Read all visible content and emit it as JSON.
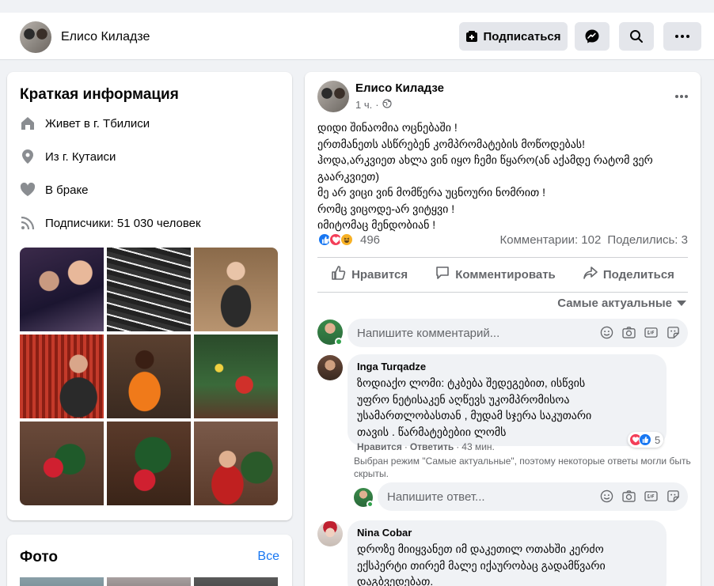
{
  "header": {
    "name": "Елисо Киладзе",
    "subscribe_label": "Подписаться"
  },
  "intro": {
    "title": "Краткая информация",
    "lives_prefix": "Живет в г.",
    "lives_city": "Тбилиси",
    "from_prefix": "Из г.",
    "from_city": "Кутаиси",
    "relationship": "В браке",
    "followers_prefix": "Подписчики:",
    "followers_count": "51 030 человек"
  },
  "photos": {
    "title": "Фото",
    "all_label": "Все"
  },
  "post": {
    "author": "Елисо Киладзе",
    "time": "1 ч.",
    "lines": [
      "დიდი შინაომია ოცნებაში !",
      "ერთმანეთს ასწრებენ კომპრომატების მოწოდებას!",
      "ჰოდა,არკვიეთ ახლა ვინ იყო ჩემი წყარო(ან აქამდე რატომ ვერ",
      "გაარკვიეთ)",
      "მე არ ვიცი ვინ მომწერა უცნოური ნომრით !",
      "რომც ვიცოდე-არ ვიტყვი !",
      "იმიტომაც მენდობიან !"
    ],
    "reactions_count": "496",
    "comments_stat": "Комментарии: 102",
    "shares_stat": "Поделились: 3",
    "like_label": "Нравится",
    "comment_label": "Комментировать",
    "share_label": "Поделиться",
    "sort_label": "Самые актуальные",
    "comment_placeholder": "Напишите комментарий..."
  },
  "comments": [
    {
      "name": "Inga Turqadze",
      "lines": [
        "ზოდიაქო ლომი: ტკბება შედეგებით, ისწვის",
        "უფრო ნეტისაკენ აღწევს უკომპრომისოა",
        "უსამართლობასთან , მუდამ სჯერა საკუთარი",
        "თავის . წარმატებებიი ლომს"
      ],
      "reactions": "5",
      "like": "Нравится",
      "reply": "Ответить",
      "time": "43 мин.",
      "note": "Выбран режим \"Самые актуальные\", поэтому некоторые ответы могли быть скрыты.",
      "reply_placeholder": "Напишите ответ..."
    },
    {
      "name": "Nina Cobar",
      "lines": [
        "დროზე მიიყვანეთ იმ დაკეთილ ოთახში კერძო",
        "ექსპერტი თირემ მალე იქაურობაც გადამწვარი",
        "დაგბვედებათ."
      ]
    }
  ],
  "colors": {
    "accent": "#1877f2",
    "muted": "#65676b",
    "surface": "#f0f2f5",
    "online": "#31a24c"
  }
}
